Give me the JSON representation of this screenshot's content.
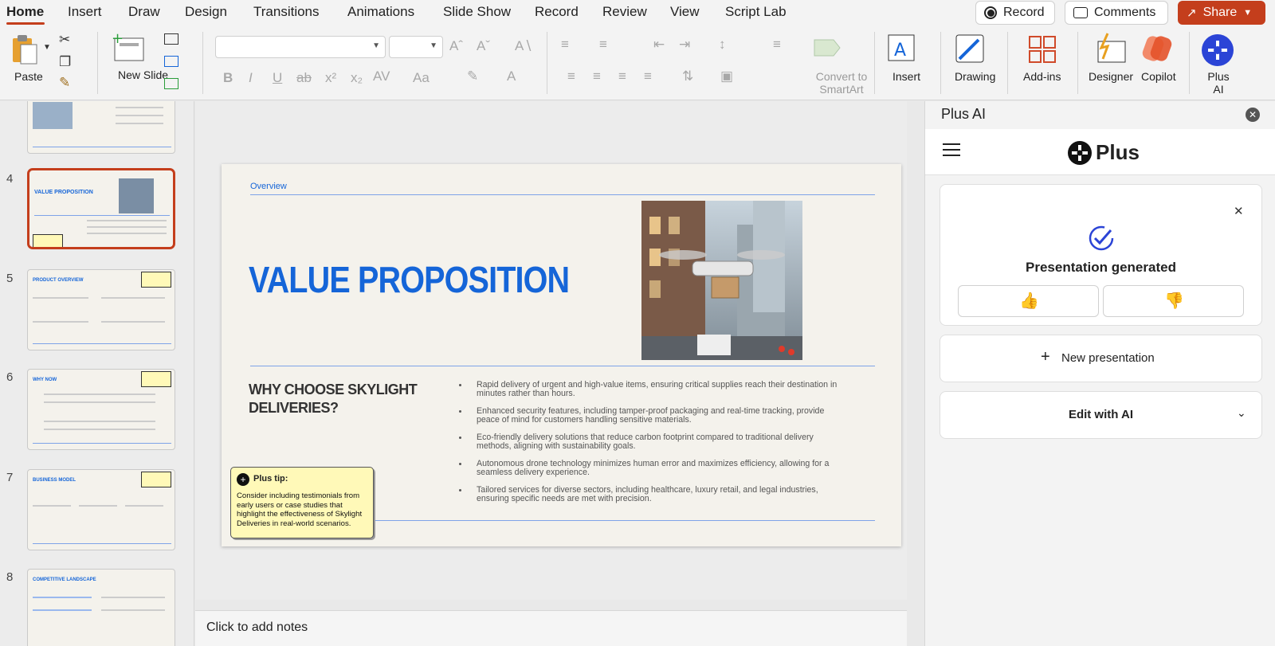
{
  "tabs": [
    "Home",
    "Insert",
    "Draw",
    "Design",
    "Transitions",
    "Animations",
    "Slide Show",
    "Record",
    "Review",
    "View",
    "Script Lab"
  ],
  "top_buttons": {
    "record": "Record",
    "comments": "Comments",
    "share": "Share"
  },
  "ribbon": {
    "paste": "Paste",
    "new_slide": "New Slide",
    "convert": "Convert to SmartArt",
    "insert": "Insert",
    "drawing": "Drawing",
    "addins": "Add-ins",
    "designer": "Designer",
    "copilot": "Copilot",
    "plus_ai": "Plus AI"
  },
  "thumbnails": [
    {
      "num": "4",
      "title": "VALUE PROPOSITION",
      "selected": true
    },
    {
      "num": "5",
      "title": "PRODUCT OVERVIEW"
    },
    {
      "num": "6",
      "title": "WHY NOW"
    },
    {
      "num": "7",
      "title": "BUSINESS MODEL"
    },
    {
      "num": "8",
      "title": "COMPETITIVE LANDSCAPE"
    }
  ],
  "slide": {
    "section": "Overview",
    "title": "VALUE PROPOSITION",
    "subtitle": "WHY CHOOSE SKYLIGHT DELIVERIES?",
    "bullets": [
      "Rapid delivery of urgent and high-value items, ensuring critical supplies reach their destination in minutes rather than hours.",
      "Enhanced security features, including tamper-proof packaging and real-time tracking, provide peace of mind for customers handling sensitive materials.",
      "Eco-friendly delivery solutions that reduce carbon footprint compared to traditional delivery methods, aligning with sustainability goals.",
      "Autonomous drone technology minimizes human error and maximizes efficiency, allowing for a seamless delivery experience.",
      "Tailored services for diverse sectors, including healthcare, luxury retail, and legal industries, ensuring specific needs are met with precision."
    ],
    "tip_title": "Plus tip:",
    "tip_text": "Consider including testimonials from early users or case studies that highlight the effectiveness of Skylight Deliveries in real-world scenarios."
  },
  "notes_placeholder": "Click to add notes",
  "panel": {
    "title": "Plus AI",
    "brand": "Plus",
    "status": "Presentation generated",
    "new_presentation": "New presentation",
    "edit_with_ai": "Edit with AI"
  },
  "colors": {
    "accent": "#c43e1c",
    "slide_blue": "#1565d8",
    "plus_blue": "#2b44d6"
  }
}
